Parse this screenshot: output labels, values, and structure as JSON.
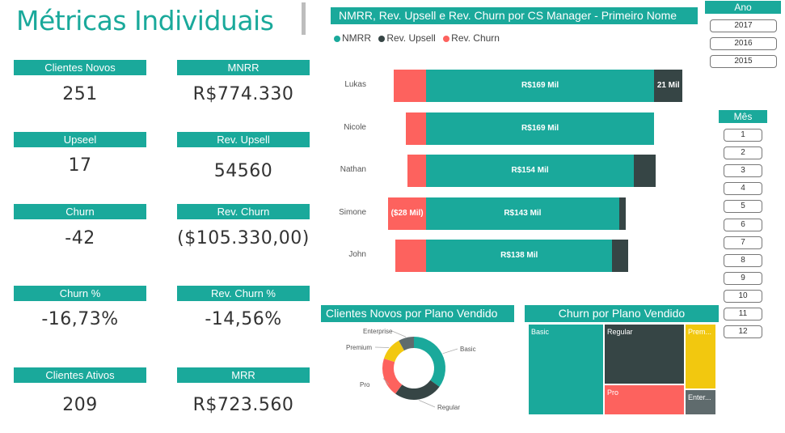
{
  "title": "Métricas Individuais",
  "colors": {
    "teal": "#1aa99b",
    "dark": "#364545",
    "red": "#fd625e",
    "yellow": "#f2c80f",
    "gray": "#5f6b6d"
  },
  "kpis": [
    {
      "label": "Clientes Novos",
      "value": "251"
    },
    {
      "label": "MNRR",
      "value": "R$774.330"
    },
    {
      "label": "Upseel",
      "value": "17"
    },
    {
      "label": "Rev. Upsell",
      "value": "54560"
    },
    {
      "label": "Churn",
      "value": "-42"
    },
    {
      "label": "Rev. Churn",
      "value": "($105.330,00)"
    },
    {
      "label": "Churn %",
      "value": "-16,73%"
    },
    {
      "label": "Rev. Churn %",
      "value": "-14,56%"
    },
    {
      "label": "Clientes Ativos",
      "value": "209"
    },
    {
      "label": "MRR",
      "value": "R$723.560"
    }
  ],
  "bar_panel": {
    "title": "NMRR, Rev. Upsell e Rev. Churn por CS Manager - Primeiro Nome",
    "legend": [
      "NMRR",
      "Rev. Upsell",
      "Rev. Churn"
    ]
  },
  "chart_data": {
    "type": "bar",
    "orientation": "horizontal",
    "stacked": true,
    "categories": [
      "Lukas",
      "Nicole",
      "Nathan",
      "Simone",
      "John"
    ],
    "series": [
      {
        "name": "NMRR",
        "values": [
          169,
          169,
          154,
          143,
          138
        ],
        "labels": [
          "R$169 Mil",
          "R$169 Mil",
          "R$154 Mil",
          "R$143 Mil",
          "R$138 Mil"
        ]
      },
      {
        "name": "Rev. Upsell",
        "values": [
          21,
          0,
          16,
          5,
          12
        ],
        "labels": [
          "21 Mil",
          "",
          "",
          "",
          ""
        ]
      },
      {
        "name": "Rev. Churn",
        "values": [
          -24,
          -15,
          -14,
          -28,
          -23
        ],
        "labels": [
          "",
          "",
          "",
          "($28 Mil)",
          ""
        ]
      }
    ],
    "unit": "Mil"
  },
  "slicers": {
    "ano": {
      "label": "Ano",
      "options": [
        "2017",
        "2016",
        "2015"
      ]
    },
    "mes": {
      "label": "Mês",
      "options": [
        "1",
        "2",
        "3",
        "4",
        "5",
        "6",
        "7",
        "8",
        "9",
        "10",
        "11",
        "12"
      ]
    }
  },
  "donut": {
    "title": "Clientes Novos por Plano Vendido",
    "segments": [
      {
        "name": "Basic",
        "value": 35
      },
      {
        "name": "Regular",
        "value": 25
      },
      {
        "name": "Pro",
        "value": 20
      },
      {
        "name": "Premium",
        "value": 12
      },
      {
        "name": "Enterprise",
        "value": 8
      }
    ]
  },
  "treemap": {
    "title": "Churn por Plano Vendido",
    "cells": [
      {
        "name": "Basic"
      },
      {
        "name": "Regular"
      },
      {
        "name": "Premium",
        "short": "Prem..."
      },
      {
        "name": "Pro"
      },
      {
        "name": "Enterprise",
        "short": "Enter..."
      }
    ]
  }
}
